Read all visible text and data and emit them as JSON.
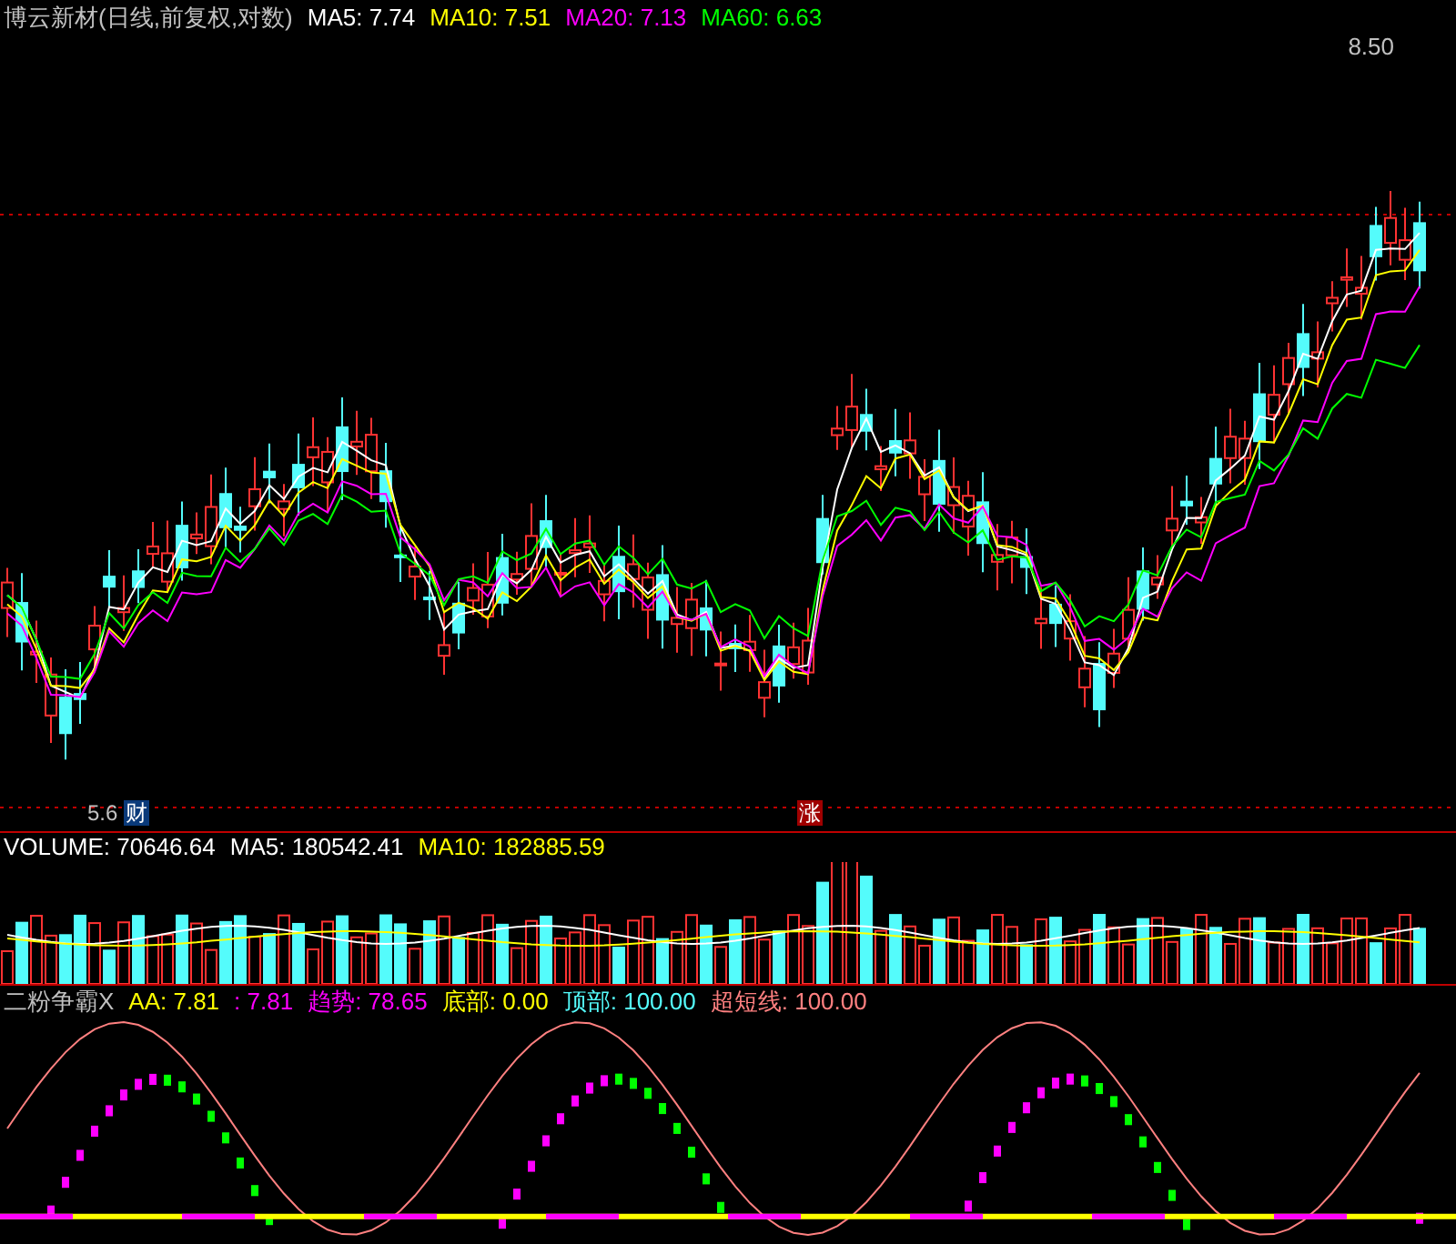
{
  "main": {
    "title": "博云新材(日线,前复权,对数)",
    "indicators": [
      {
        "label": "MA5: 7.74",
        "color": "#ffffff"
      },
      {
        "label": "MA10: 7.51",
        "color": "#ffff00"
      },
      {
        "label": "MA20: 7.13",
        "color": "#ff00ff"
      },
      {
        "label": "MA60: 6.63",
        "color": "#00ff00"
      }
    ],
    "high_label": "8.50",
    "low_label": "5.6",
    "badges": [
      {
        "text": "财",
        "kind": "finance"
      },
      {
        "text": "涨",
        "kind": "rise"
      }
    ]
  },
  "volume": {
    "indicators": [
      {
        "label": "VOLUME: 70646.64",
        "color": "#ffffff"
      },
      {
        "label": "MA5: 180542.41",
        "color": "#ffffff"
      },
      {
        "label": "MA10: 182885.59",
        "color": "#ffff00"
      }
    ]
  },
  "oscillator": {
    "title": "二粉争霸X",
    "indicators": [
      {
        "label": "AA: 7.81",
        "color": "#ffff00"
      },
      {
        "label": ": 7.81",
        "color": "#ff00ff"
      },
      {
        "label": "趋势: 78.65",
        "color": "#ff00ff"
      },
      {
        "label": "底部: 0.00",
        "color": "#ffff00"
      },
      {
        "label": "顶部: 100.00",
        "color": "#54fcfc"
      },
      {
        "label": "超短线: 100.00",
        "color": "#ff8080"
      }
    ]
  }
}
